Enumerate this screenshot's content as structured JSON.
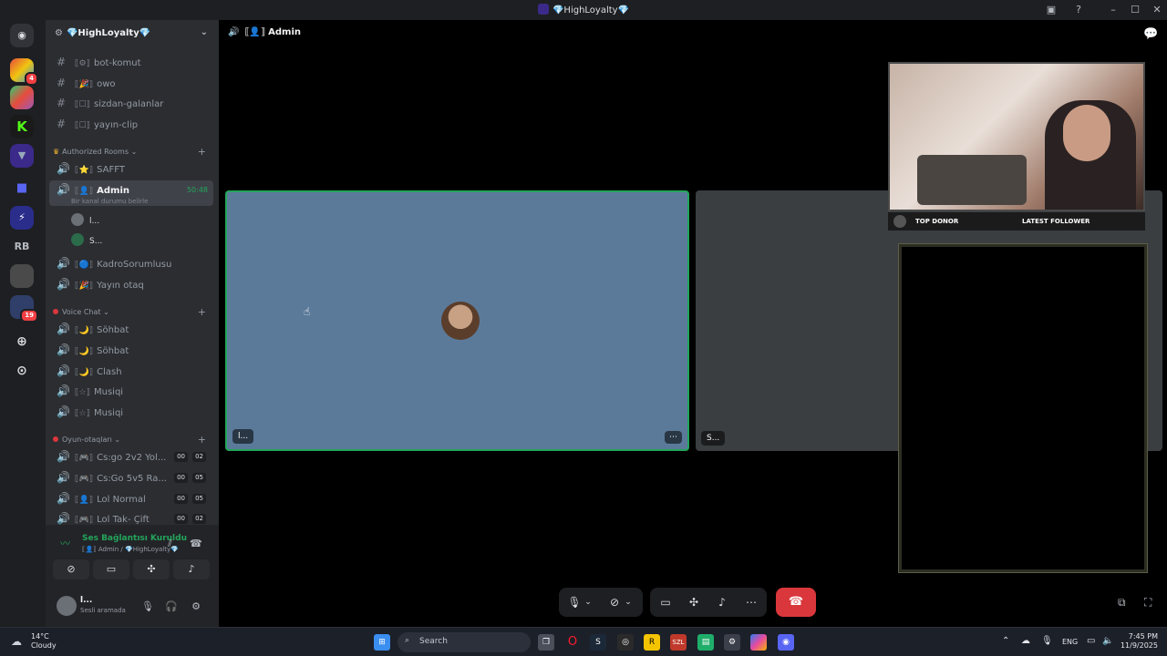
{
  "window": {
    "title": "💎HighLoyalty💎"
  },
  "rail": {
    "servers": [
      {
        "name": "server-1",
        "label": ""
      },
      {
        "name": "server-2",
        "label": ""
      },
      {
        "name": "server-k",
        "label": "K"
      },
      {
        "name": "server-highloyalty",
        "label": ""
      },
      {
        "name": "server-folder",
        "label": ""
      },
      {
        "name": "server-runner",
        "label": ""
      },
      {
        "name": "server-rb",
        "label": "RB"
      },
      {
        "name": "server-8",
        "label": ""
      },
      {
        "name": "server-9",
        "label": "",
        "badge": "19"
      }
    ],
    "badge_top": "4",
    "badge_bottom": "19"
  },
  "sidebar": {
    "guild_name": "💎HighLoyalty💎",
    "text_channels": [
      {
        "deco": "⟦⚙⟧",
        "label": "bot-komut"
      },
      {
        "deco": "⟦🎉⟧",
        "label": "owo"
      },
      {
        "deco": "⟦☐⟧",
        "label": "sizdan-galanlar"
      },
      {
        "deco": "⟦☐⟧",
        "label": "yayın-clip"
      }
    ],
    "categories": {
      "authorized": "Authorized Rooms",
      "voice_chat": "Voice Chat",
      "oyun": "Oyun-otaqları"
    },
    "authorized_rooms": [
      {
        "deco": "⟦⭐⟧",
        "label": "SAFFT"
      },
      {
        "deco": "⟦👤⟧",
        "label": "Admin",
        "timer": "50:48",
        "status": "Bir kanal durumu belirle"
      },
      {
        "deco": "⟦🔵⟧",
        "label": "KadroSorumlusu"
      },
      {
        "deco": "⟦🎉⟧",
        "label": "Yayın otaq"
      }
    ],
    "voice_users": [
      {
        "label": "l..."
      },
      {
        "label": "S..."
      }
    ],
    "voice_chat_rooms": [
      {
        "deco": "⟦🌙⟧",
        "label": "Söhbat"
      },
      {
        "deco": "⟦🌙⟧",
        "label": "Söhbat"
      },
      {
        "deco": "⟦🌙⟧",
        "label": "Clash"
      },
      {
        "deco": "⟦☆⟧",
        "label": "Musiqi"
      },
      {
        "deco": "⟦☆⟧",
        "label": "Musiqi"
      }
    ],
    "game_rooms": [
      {
        "deco": "⟦🎮⟧",
        "label": "Cs:go 2v2 Yol...",
        "a": "00",
        "b": "02"
      },
      {
        "deco": "⟦🎮⟧",
        "label": "Cs:Go 5v5 Ra...",
        "a": "00",
        "b": "05"
      },
      {
        "deco": "⟦👤⟧",
        "label": "Lol Normal",
        "a": "00",
        "b": "05"
      },
      {
        "deco": "⟦🎮⟧",
        "label": "Lol Tak- Çift",
        "a": "00",
        "b": "02"
      }
    ]
  },
  "voice_panel": {
    "connected": "Ses Bağlantısı Kuruldu",
    "location": "⟦👤⟧ Admin / 💎HighLoyalty💎"
  },
  "user_panel": {
    "name": "l...",
    "status": "Sesli aramada"
  },
  "stage": {
    "channel_title": "⟦👤⟧ Admin",
    "tile_left_label": "l...",
    "tile_right_label": "S..."
  },
  "overlay": {
    "top_donor": "TOP DONOR",
    "latest_follower": "LATEST FOLLOWER"
  },
  "taskbar": {
    "temp": "14°C",
    "condition": "Cloudy",
    "search_placeholder": "Search",
    "lang": "ENG",
    "time": "7:45 PM",
    "date": "11/9/2025"
  },
  "colors": {
    "accent_green": "#23a55a",
    "hangup_red": "#da373c",
    "tile_blue": "#5b7a9a",
    "tile_gray": "#3a3e40"
  }
}
